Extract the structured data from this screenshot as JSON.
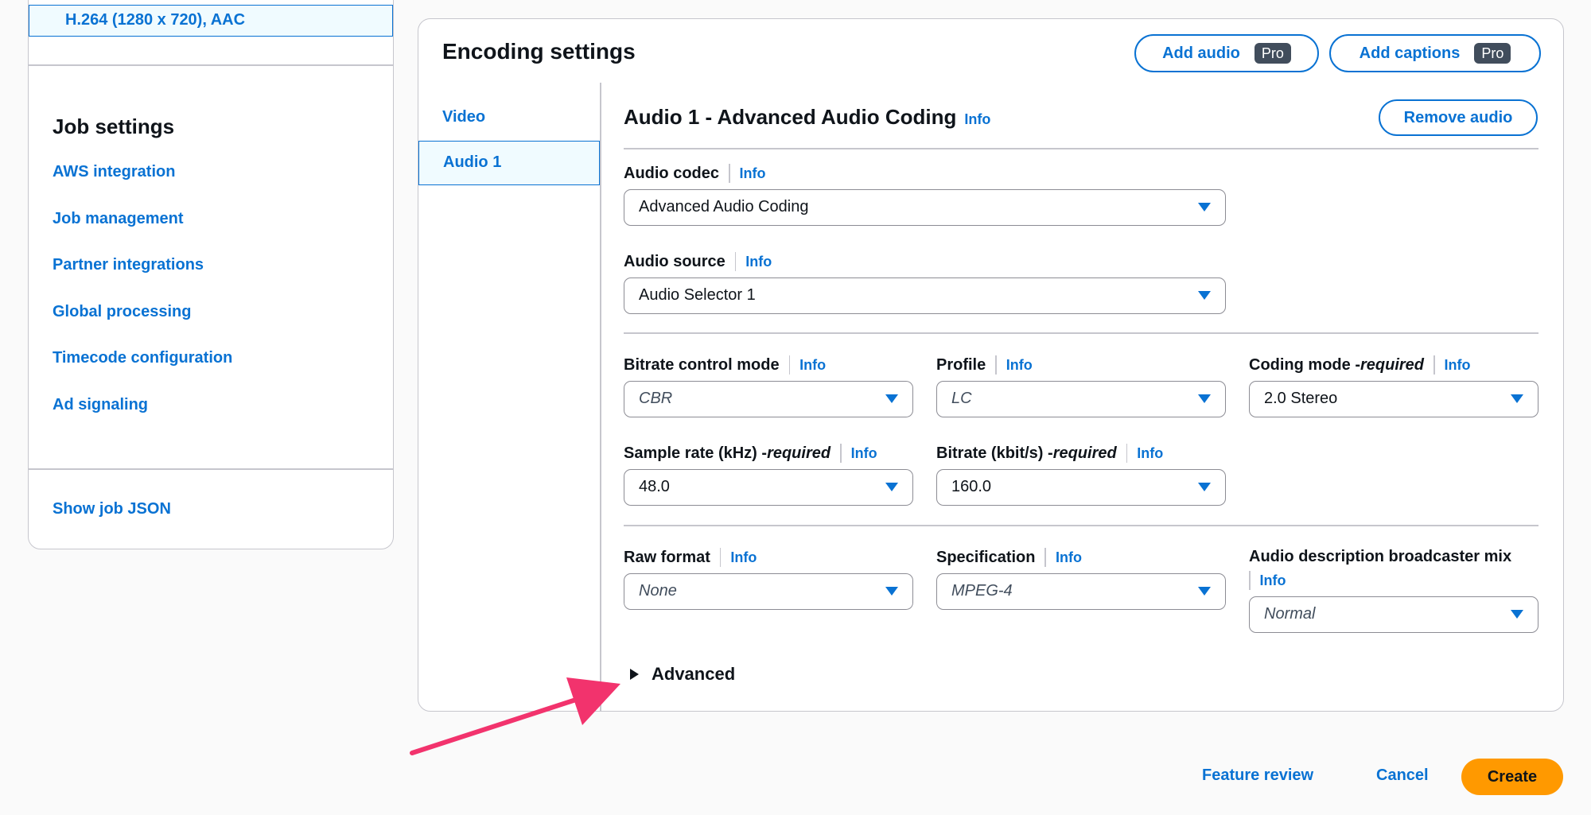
{
  "output_summary": "H.264 (1280 x 720), AAC",
  "job_settings": {
    "title": "Job settings",
    "links": [
      "AWS integration",
      "Job management",
      "Partner integrations",
      "Global processing",
      "Timecode configuration",
      "Ad signaling"
    ],
    "show_json": "Show job JSON"
  },
  "encoding": {
    "title": "Encoding settings",
    "add_audio": "Add audio",
    "add_captions": "Add captions",
    "pro_badge": "Pro",
    "tabs": [
      "Video",
      "Audio 1"
    ],
    "audio": {
      "title": "Audio 1 - Advanced Audio Coding",
      "info": "Info",
      "remove_audio": "Remove audio",
      "codec": {
        "label": "Audio codec",
        "value": "Advanced Audio Coding"
      },
      "source": {
        "label": "Audio source",
        "value": "Audio Selector 1"
      },
      "bitrate_mode": {
        "label": "Bitrate control mode",
        "value": "CBR"
      },
      "profile": {
        "label": "Profile",
        "value": "LC"
      },
      "coding_mode": {
        "label": "Coding mode - ",
        "required": "required",
        "value": "2.0 Stereo"
      },
      "sample_rate": {
        "label": "Sample rate (kHz) - ",
        "required": "required",
        "value": "48.0"
      },
      "bitrate": {
        "label": "Bitrate (kbit/s) - ",
        "required": "required",
        "value": "160.0"
      },
      "raw_format": {
        "label": "Raw format",
        "value": "None"
      },
      "specification": {
        "label": "Specification",
        "value": "MPEG-4"
      },
      "broadcaster_mix": {
        "label": "Audio description broadcaster mix",
        "value": "Normal"
      },
      "advanced": "Advanced"
    }
  },
  "footer": {
    "feature_review": "Feature review",
    "cancel": "Cancel",
    "create": "Create"
  },
  "colors": {
    "link": "#0972d3",
    "primary_button": "#ff9900",
    "annotation_arrow": "#f2336d"
  }
}
